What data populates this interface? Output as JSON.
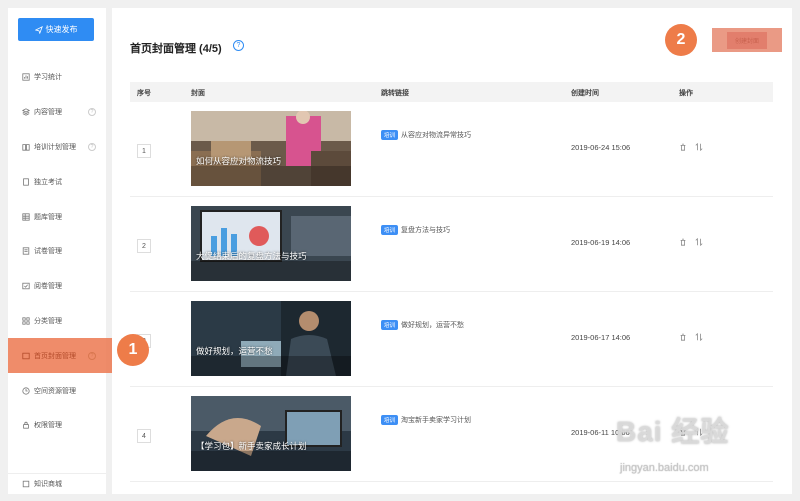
{
  "sidebar": {
    "publish_label": "快速发布",
    "items": [
      {
        "label": "学习统计",
        "icon": "chart-icon",
        "info": false
      },
      {
        "label": "内容管理",
        "icon": "layers-icon",
        "info": true
      },
      {
        "label": "培训计划管理",
        "icon": "book-icon",
        "info": true
      },
      {
        "label": "独立考试",
        "icon": "document-icon",
        "info": false
      },
      {
        "label": "题库管理",
        "icon": "grid-list-icon",
        "info": false
      },
      {
        "label": "试卷管理",
        "icon": "paper-icon",
        "info": false
      },
      {
        "label": "阅卷管理",
        "icon": "review-icon",
        "info": false
      },
      {
        "label": "分类管理",
        "icon": "category-icon",
        "info": false
      },
      {
        "label": "首页封面管理",
        "icon": "cover-icon",
        "info": true,
        "active": true
      },
      {
        "label": "空间资源管理",
        "icon": "clock-icon",
        "info": false
      },
      {
        "label": "权限管理",
        "icon": "lock-icon",
        "info": false
      }
    ],
    "footer_label": "知识商城",
    "info_glyph": "?"
  },
  "main": {
    "title": "首页封面管理 (4/5)",
    "help_glyph": "?",
    "create_label": "创建封面",
    "columns": [
      "序号",
      "封面",
      "跳转链接",
      "创建时间",
      "操作"
    ],
    "rows": [
      {
        "index": "1",
        "cover_caption": "如何从容应对物流技巧",
        "tag": "培训",
        "link": "从容应对物流异常技巧",
        "created": "2019-06-24 15:06"
      },
      {
        "index": "2",
        "cover_caption": "大促结束后的复盘方法与技巧",
        "tag": "培训",
        "link": "复盘方法与技巧",
        "created": "2019-06-19 14:06"
      },
      {
        "index": "3",
        "cover_caption": "做好规划，运营不愁",
        "tag": "培训",
        "link": "做好规划，运营不愁",
        "created": "2019-06-17 14:06"
      },
      {
        "index": "4",
        "cover_caption": "【学习包】新手卖家成长计划",
        "tag": "培训",
        "link": "淘宝新手卖家学习计划",
        "created": "2019-06-11 10:06"
      }
    ]
  },
  "annotations": {
    "badge1": "1",
    "badge2": "2"
  },
  "watermark": {
    "logo": "Bai 经验",
    "url": "jingyan.baidu.com"
  },
  "colors": {
    "primary": "#2f8cf3",
    "highlight": "#ee7c49",
    "tag": "#3d8ff5"
  }
}
